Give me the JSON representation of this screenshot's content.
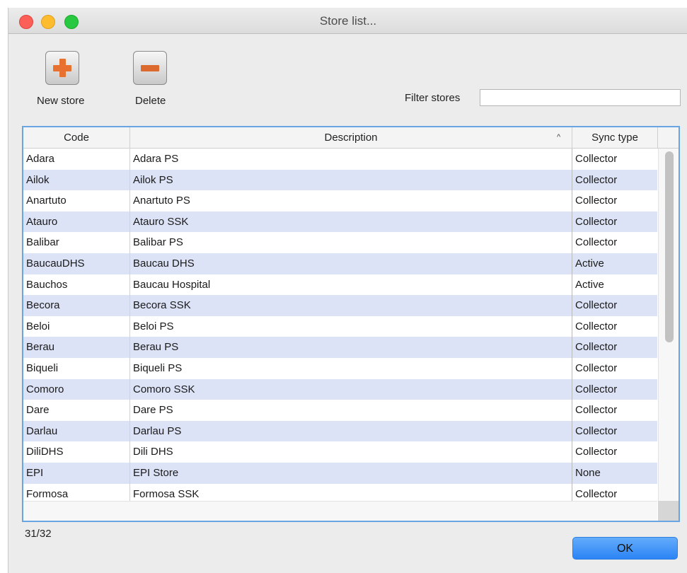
{
  "window": {
    "title": "Store list..."
  },
  "toolbar": {
    "new_label": "New store",
    "delete_label": "Delete"
  },
  "filter": {
    "label": "Filter stores",
    "value": "",
    "placeholder": ""
  },
  "table": {
    "columns": {
      "code": "Code",
      "description": "Description",
      "sync": "Sync type"
    },
    "sort_indicator": "^",
    "rows": [
      {
        "code": "Adara",
        "description": "Adara PS",
        "sync": "Collector"
      },
      {
        "code": "Ailok",
        "description": "Ailok PS",
        "sync": "Collector"
      },
      {
        "code": "Anartuto",
        "description": "Anartuto PS",
        "sync": "Collector"
      },
      {
        "code": "Atauro",
        "description": "Atauro SSK",
        "sync": "Collector"
      },
      {
        "code": "Balibar",
        "description": "Balibar PS",
        "sync": "Collector"
      },
      {
        "code": "BaucauDHS",
        "description": "Baucau DHS",
        "sync": "Active"
      },
      {
        "code": "Bauchos",
        "description": "Baucau Hospital",
        "sync": "Active"
      },
      {
        "code": "Becora",
        "description": "Becora SSK",
        "sync": "Collector"
      },
      {
        "code": "Beloi",
        "description": "Beloi PS",
        "sync": "Collector"
      },
      {
        "code": "Berau",
        "description": "Berau PS",
        "sync": "Collector"
      },
      {
        "code": "Biqueli",
        "description": "Biqueli PS",
        "sync": "Collector"
      },
      {
        "code": "Comoro",
        "description": "Comoro SSK",
        "sync": "Collector"
      },
      {
        "code": "Dare",
        "description": "Dare PS",
        "sync": "Collector"
      },
      {
        "code": "Darlau",
        "description": "Darlau PS",
        "sync": "Collector"
      },
      {
        "code": "DiliDHS",
        "description": "Dili DHS",
        "sync": "Collector"
      },
      {
        "code": "EPI",
        "description": "EPI Store",
        "sync": "None"
      },
      {
        "code": "Formosa",
        "description": "Formosa SSK",
        "sync": "Collector"
      }
    ]
  },
  "footer": {
    "count": "31/32",
    "ok_label": "OK"
  },
  "colors": {
    "accent": "#2b84f5",
    "row_stripe": "#dde3f7",
    "table_focus_border": "#6aa5e3",
    "toolbar_icon": "#e9712f"
  }
}
